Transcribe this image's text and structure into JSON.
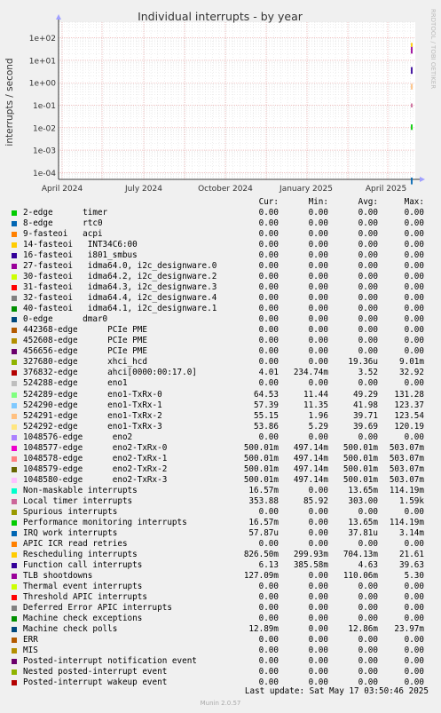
{
  "chart_data": {
    "type": "line",
    "title": "Individual interrupts - by year",
    "ylabel": "interrupts / second",
    "yscale": "log",
    "ylim": [
      5e-05,
      500
    ],
    "yticks": [
      "1e+02",
      "1e+01",
      "1e+00",
      "1e-01",
      "1e-02",
      "1e-03",
      "1e-04"
    ],
    "xticks": [
      "April 2024",
      "July 2024",
      "October 2024",
      "January 2025",
      "April 2025"
    ],
    "watermark": "RRDTOOL / TOBI OETIKER",
    "footer": "Munin 2.0.57",
    "last_update": "Last update: Sat May 17 03:50:46 2025",
    "columns": [
      "Cur:",
      "Min:",
      "Avg:",
      "Max:"
    ],
    "grid": true,
    "series": [
      {
        "name": "2-edge      timer",
        "color": "#00cc00",
        "values": [
          "0.00",
          "0.00",
          "0.00",
          "0.00"
        ]
      },
      {
        "name": "8-edge      rtc0",
        "color": "#0066b3",
        "values": [
          "0.00",
          "0.00",
          "0.00",
          "0.00"
        ]
      },
      {
        "name": "9-fasteoi   acpi",
        "color": "#ff8000",
        "values": [
          "0.00",
          "0.00",
          "0.00",
          "0.00"
        ]
      },
      {
        "name": "14-fasteoi   INT34C6:00",
        "color": "#ffcc00",
        "values": [
          "0.00",
          "0.00",
          "0.00",
          "0.00"
        ]
      },
      {
        "name": "16-fasteoi   i801_smbus",
        "color": "#330099",
        "values": [
          "0.00",
          "0.00",
          "0.00",
          "0.00"
        ]
      },
      {
        "name": "27-fasteoi   idma64.0, i2c_designware.0",
        "color": "#990099",
        "values": [
          "0.00",
          "0.00",
          "0.00",
          "0.00"
        ]
      },
      {
        "name": "30-fasteoi   idma64.2, i2c_designware.2",
        "color": "#ccff00",
        "values": [
          "0.00",
          "0.00",
          "0.00",
          "0.00"
        ]
      },
      {
        "name": "31-fasteoi   idma64.3, i2c_designware.3",
        "color": "#ff0000",
        "values": [
          "0.00",
          "0.00",
          "0.00",
          "0.00"
        ]
      },
      {
        "name": "32-fasteoi   idma64.4, i2c_designware.4",
        "color": "#808080",
        "values": [
          "0.00",
          "0.00",
          "0.00",
          "0.00"
        ]
      },
      {
        "name": "40-fasteoi   idma64.1, i2c_designware.1",
        "color": "#008f00",
        "values": [
          "0.00",
          "0.00",
          "0.00",
          "0.00"
        ]
      },
      {
        "name": "0-edge      dmar0",
        "color": "#00487d",
        "values": [
          "0.00",
          "0.00",
          "0.00",
          "0.00"
        ]
      },
      {
        "name": "442368-edge      PCIe PME",
        "color": "#b35a00",
        "values": [
          "0.00",
          "0.00",
          "0.00",
          "0.00"
        ]
      },
      {
        "name": "452608-edge      PCIe PME",
        "color": "#b38f00",
        "values": [
          "0.00",
          "0.00",
          "0.00",
          "0.00"
        ]
      },
      {
        "name": "456656-edge      PCIe PME",
        "color": "#6b006b",
        "values": [
          "0.00",
          "0.00",
          "0.00",
          "0.00"
        ]
      },
      {
        "name": "327680-edge      xhci_hcd",
        "color": "#8fb300",
        "values": [
          "0.00",
          "0.00",
          "19.36u",
          "9.01m"
        ]
      },
      {
        "name": "376832-edge      ahci[0000:00:17.0]",
        "color": "#b30000",
        "values": [
          "4.01",
          "234.74m",
          "3.52",
          "32.92"
        ]
      },
      {
        "name": "524288-edge      eno1",
        "color": "#bebebe",
        "values": [
          "0.00",
          "0.00",
          "0.00",
          "0.00"
        ]
      },
      {
        "name": "524289-edge      eno1-TxRx-0",
        "color": "#80ff80",
        "values": [
          "64.53",
          "11.44",
          "49.29",
          "131.28"
        ]
      },
      {
        "name": "524290-edge      eno1-TxRx-1",
        "color": "#80c9ff",
        "values": [
          "57.39",
          "11.35",
          "41.98",
          "123.37"
        ]
      },
      {
        "name": "524291-edge      eno1-TxRx-2",
        "color": "#ffc080",
        "values": [
          "55.15",
          "1.96",
          "39.71",
          "123.54"
        ]
      },
      {
        "name": "524292-edge      eno1-TxRx-3",
        "color": "#ffe680",
        "values": [
          "53.86",
          "5.29",
          "39.69",
          "120.19"
        ]
      },
      {
        "name": "1048576-edge      eno2",
        "color": "#aa80ff",
        "values": [
          "0.00",
          "0.00",
          "0.00",
          "0.00"
        ]
      },
      {
        "name": "1048577-edge      eno2-TxRx-0",
        "color": "#ee00cc",
        "values": [
          "500.01m",
          "497.14m",
          "500.01m",
          "503.07m"
        ]
      },
      {
        "name": "1048578-edge      eno2-TxRx-1",
        "color": "#ff8080",
        "values": [
          "500.01m",
          "497.14m",
          "500.01m",
          "503.07m"
        ]
      },
      {
        "name": "1048579-edge      eno2-TxRx-2",
        "color": "#666600",
        "values": [
          "500.01m",
          "497.14m",
          "500.01m",
          "503.07m"
        ]
      },
      {
        "name": "1048580-edge      eno2-TxRx-3",
        "color": "#ffbfff",
        "values": [
          "500.01m",
          "497.14m",
          "500.01m",
          "503.07m"
        ]
      },
      {
        "name": "Non-maskable interrupts",
        "color": "#00ffcc",
        "values": [
          "16.57m",
          "0.00",
          "13.65m",
          "114.19m"
        ]
      },
      {
        "name": "Local timer interrupts",
        "color": "#cc6699",
        "values": [
          "353.88",
          "85.92",
          "303.00",
          "1.59k"
        ]
      },
      {
        "name": "Spurious interrupts",
        "color": "#999900",
        "values": [
          "0.00",
          "0.00",
          "0.00",
          "0.00"
        ]
      },
      {
        "name": "Performance monitoring interrupts",
        "color": "#00cc00",
        "values": [
          "16.57m",
          "0.00",
          "13.65m",
          "114.19m"
        ]
      },
      {
        "name": "IRQ work interrupts",
        "color": "#0066b3",
        "values": [
          "57.87u",
          "0.00",
          "37.81u",
          "3.14m"
        ]
      },
      {
        "name": "APIC ICR read retries",
        "color": "#ff8000",
        "values": [
          "0.00",
          "0.00",
          "0.00",
          "0.00"
        ]
      },
      {
        "name": "Rescheduling interrupts",
        "color": "#ffcc00",
        "values": [
          "826.50m",
          "299.93m",
          "704.13m",
          "21.61"
        ]
      },
      {
        "name": "Function call interrupts",
        "color": "#330099",
        "values": [
          "6.13",
          "385.58m",
          "4.63",
          "39.63"
        ]
      },
      {
        "name": "TLB shootdowns",
        "color": "#990099",
        "values": [
          "127.09m",
          "0.00",
          "110.06m",
          "5.30"
        ]
      },
      {
        "name": "Thermal event interrupts",
        "color": "#ccff00",
        "values": [
          "0.00",
          "0.00",
          "0.00",
          "0.00"
        ]
      },
      {
        "name": "Threshold APIC interrupts",
        "color": "#ff0000",
        "values": [
          "0.00",
          "0.00",
          "0.00",
          "0.00"
        ]
      },
      {
        "name": "Deferred Error APIC interrupts",
        "color": "#808080",
        "values": [
          "0.00",
          "0.00",
          "0.00",
          "0.00"
        ]
      },
      {
        "name": "Machine check exceptions",
        "color": "#008f00",
        "values": [
          "0.00",
          "0.00",
          "0.00",
          "0.00"
        ]
      },
      {
        "name": "Machine check polls",
        "color": "#00487d",
        "values": [
          "12.89m",
          "0.00",
          "12.86m",
          "23.97m"
        ]
      },
      {
        "name": "ERR",
        "color": "#b35a00",
        "values": [
          "0.00",
          "0.00",
          "0.00",
          "0.00"
        ]
      },
      {
        "name": "MIS",
        "color": "#b38f00",
        "values": [
          "0.00",
          "0.00",
          "0.00",
          "0.00"
        ]
      },
      {
        "name": "Posted-interrupt notification event",
        "color": "#6b006b",
        "values": [
          "0.00",
          "0.00",
          "0.00",
          "0.00"
        ]
      },
      {
        "name": "Nested posted-interrupt event",
        "color": "#8fb300",
        "values": [
          "0.00",
          "0.00",
          "0.00",
          "0.00"
        ]
      },
      {
        "name": "Posted-interrupt wakeup event",
        "color": "#b30000",
        "values": [
          "0.00",
          "0.00",
          "0.00",
          "0.00"
        ]
      }
    ],
    "marks": [
      {
        "color": "#990099",
        "y": [
          20,
          40
        ]
      },
      {
        "color": "#ffcc00",
        "y": [
          40,
          60
        ]
      },
      {
        "color": "#330099",
        "y": [
          2.5,
          5
        ]
      },
      {
        "color": "#ffc080",
        "y": [
          0.5,
          0.9
        ]
      },
      {
        "color": "#cc6699",
        "y": [
          0.08,
          0.12
        ]
      },
      {
        "color": "#00cc00",
        "y": [
          0.008,
          0.014
        ]
      },
      {
        "color": "#0066b3",
        "y": [
          3e-05,
          6e-05
        ]
      }
    ]
  }
}
